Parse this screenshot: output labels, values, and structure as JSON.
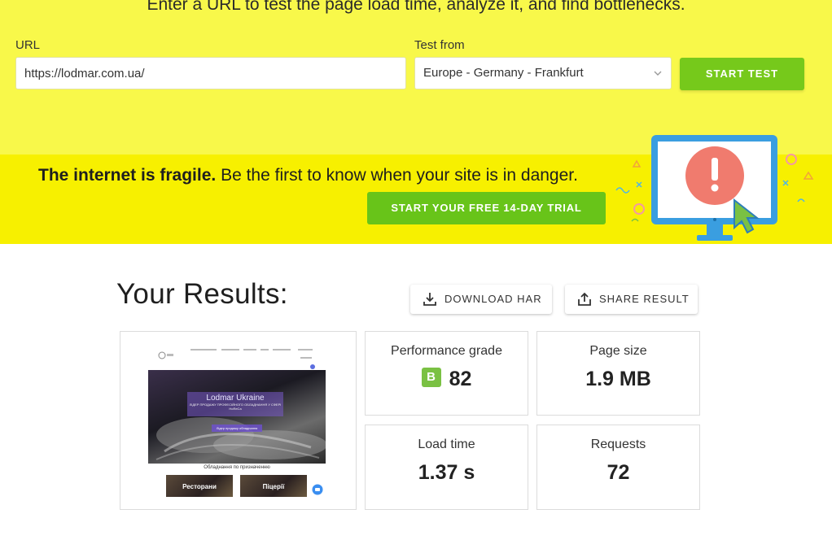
{
  "test_form": {
    "tagline": "Enter a URL to test the page load time, analyze it, and find bottlenecks.",
    "url_label": "URL",
    "url_value": "https://lodmar.com.ua/",
    "location_label": "Test from",
    "location_value": "Europe - Germany - Frankfurt",
    "start_button": "START TEST"
  },
  "promo": {
    "headline_bold": "The internet is fragile.",
    "headline_rest": "Be the first to know when your site is in danger.",
    "trial_button": "START YOUR FREE 14-DAY TRIAL"
  },
  "results": {
    "title": "Your Results:",
    "download_button": "DOWNLOAD HAR",
    "share_button": "SHARE RESULT",
    "metrics": {
      "performance": {
        "label": "Performance grade",
        "grade": "B",
        "value": "82"
      },
      "page_size": {
        "label": "Page size",
        "value": "1.9 MB"
      },
      "load_time": {
        "label": "Load time",
        "value": "1.37 s"
      },
      "requests": {
        "label": "Requests",
        "value": "72"
      }
    }
  },
  "screenshot_preview": {
    "hero_title": "Lodmar Ukraine",
    "hero_subtitle": "ЛІДЕР ПРОДАЖУ ПРОФЕСІЙНОГО ОБЛАДНАННЯ У СФЕРІ HoReCa",
    "hero_button": "Лідер продажу обладнання",
    "section_title": "Обладнання по призначенню",
    "card_1": "Ресторани",
    "card_2": "Піцерії"
  },
  "colors": {
    "top_band": "#f8f84a",
    "promo_band": "#f7f000",
    "primary_green": "#76c91b",
    "grade_badge": "#7ac143"
  }
}
